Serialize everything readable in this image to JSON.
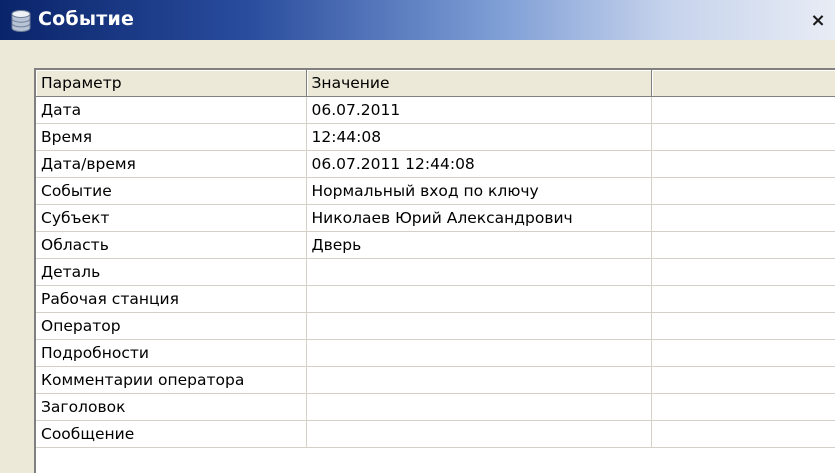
{
  "window": {
    "title": "Событие",
    "close_glyph": "×"
  },
  "table": {
    "headers": [
      "Параметр",
      "Значение",
      ""
    ],
    "rows": [
      {
        "param": "Дата",
        "value": "06.07.2011"
      },
      {
        "param": "Время",
        "value": "12:44:08"
      },
      {
        "param": "Дата/время",
        "value": "06.07.2011 12:44:08"
      },
      {
        "param": "Событие",
        "value": "Нормальный вход по ключу"
      },
      {
        "param": "Субъект",
        "value": "Николаев Юрий Александрович"
      },
      {
        "param": "Область",
        "value": "Дверь"
      },
      {
        "param": "Деталь",
        "value": ""
      },
      {
        "param": "Рабочая станция",
        "value": ""
      },
      {
        "param": "Оператор",
        "value": ""
      },
      {
        "param": "Подробности",
        "value": ""
      },
      {
        "param": "Комментарии оператора",
        "value": ""
      },
      {
        "param": "Заголовок",
        "value": ""
      },
      {
        "param": "Сообщение",
        "value": ""
      }
    ]
  },
  "colors": {
    "titlebar_start": "#0a246a",
    "titlebar_end": "#e8ecf5",
    "face": "#ece9d8"
  }
}
